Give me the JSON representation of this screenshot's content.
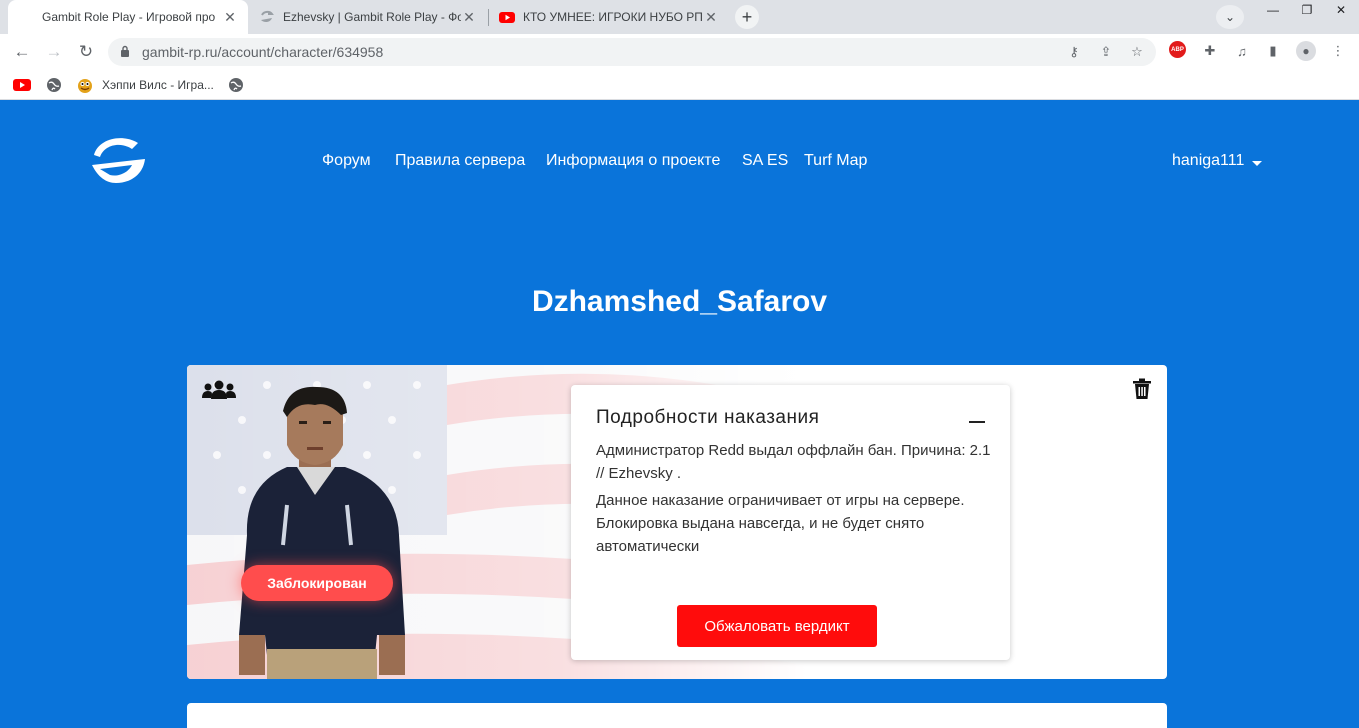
{
  "browser": {
    "tabs": [
      {
        "title": "Gambit Role Play - Игровой про",
        "active": true
      },
      {
        "title": "Ezhevsky | Gambit Role Play - Фо",
        "active": false
      },
      {
        "title": "КТО УМНЕЕ: ИГРОКИ НУБО РП |",
        "active": false
      }
    ],
    "new_tab": "+",
    "url": "gambit-rp.ru/account/character/634958",
    "bookmarks": [
      {
        "label": "",
        "icon": "youtube-icon"
      },
      {
        "label": "",
        "icon": "globe-icon"
      },
      {
        "label": "Хэппи Вилс - Игра...",
        "icon": "happy-wheels-icon"
      },
      {
        "label": "",
        "icon": "globe-icon"
      }
    ],
    "colors": {
      "tabstrip": "#dee1e6",
      "omnibox": "#f1f3f4"
    }
  },
  "site": {
    "nav": [
      {
        "label": "Форум"
      },
      {
        "label": "Правила сервера"
      },
      {
        "label": "Информация о проекте"
      },
      {
        "label": "SA ES"
      },
      {
        "label": "Turf Map"
      }
    ],
    "username": "haniga111",
    "colors": {
      "background": "#0a74da",
      "accent_red": "#ff0c0c",
      "badge_red": "#ff4d4d"
    }
  },
  "character": {
    "name": "Dzhamshed_Safarov",
    "status_badge": "Заблокирован"
  },
  "punishment": {
    "title": "Подробности наказания",
    "reason_text": "Администратор Redd выдал оффлайн бан. Причина: 2.1 // Ezhevsky .",
    "description": "Данное наказание ограничивает от игры на сервере. Блокировка выдана навсегда, и не будет снято автоматически",
    "appeal_button": "Обжаловать вердикт"
  }
}
